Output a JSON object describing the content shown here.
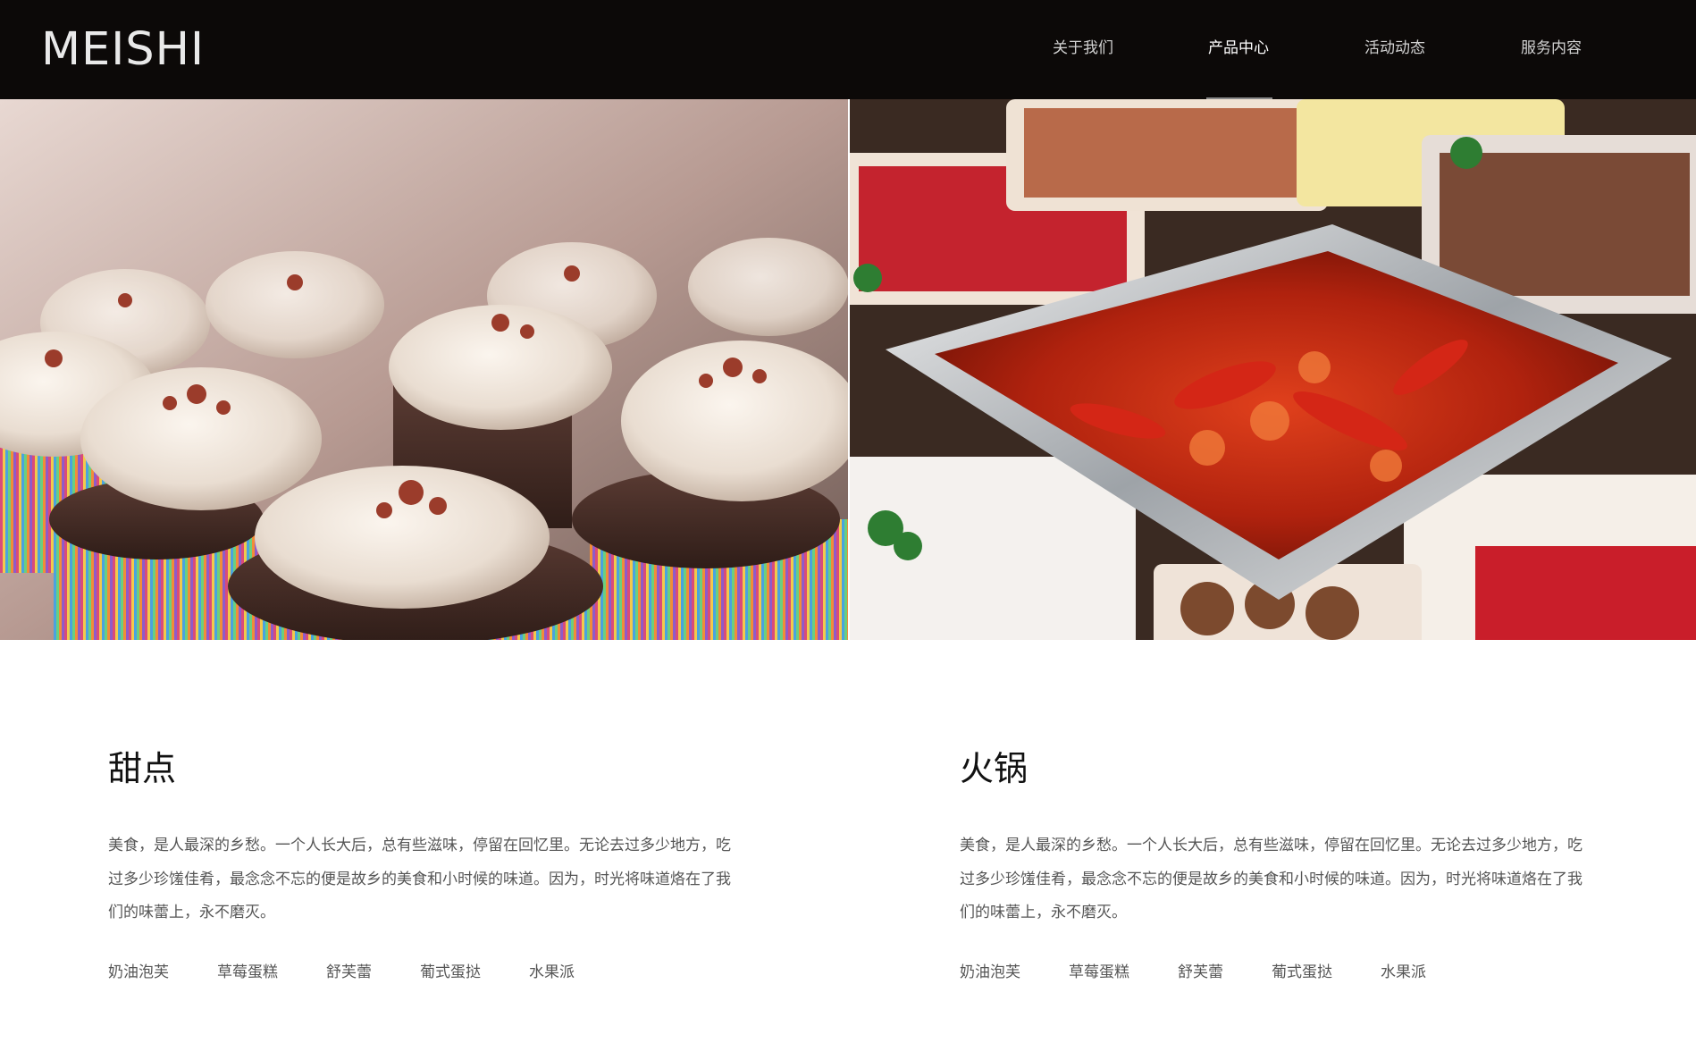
{
  "header": {
    "logo": "MEISHI",
    "nav": [
      {
        "label": "关于我们",
        "active": false
      },
      {
        "label": "产品中心",
        "active": true
      },
      {
        "label": "活动动态",
        "active": false
      },
      {
        "label": "服务内容",
        "active": false
      }
    ]
  },
  "sections": [
    {
      "title": "甜点",
      "description": "美食，是人最深的乡愁。一个人长大后，总有些滋味，停留在回忆里。无论去过多少地方，吃过多少珍馐佳肴，最念念不忘的便是故乡的美食和小时候的味道。因为，时光将味道烙在了我们的味蕾上，永不磨灭。",
      "tags": [
        "奶油泡芙",
        "草莓蛋糕",
        "舒芙蕾",
        "葡式蛋挞",
        "水果派"
      ]
    },
    {
      "title": "火锅",
      "description": "美食，是人最深的乡愁。一个人长大后，总有些滋味，停留在回忆里。无论去过多少地方，吃过多少珍馐佳肴，最念念不忘的便是故乡的美食和小时候的味道。因为，时光将味道烙在了我们的味蕾上，永不磨灭。",
      "tags": [
        "奶油泡芙",
        "草莓蛋糕",
        "舒芙蕾",
        "葡式蛋挞",
        "水果派"
      ]
    }
  ]
}
